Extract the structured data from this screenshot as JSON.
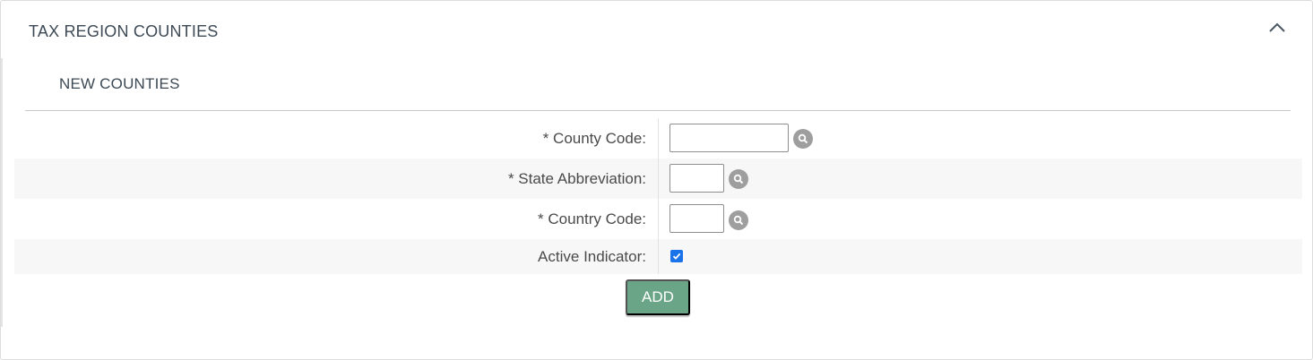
{
  "panel": {
    "title": "TAX REGION COUNTIES",
    "collapse_icon": "chevron-up-icon"
  },
  "section": {
    "title": "NEW COUNTIES"
  },
  "form": {
    "county_code": {
      "label": "*  County Code:",
      "value": "",
      "lookup_icon": "search-icon"
    },
    "state_abbreviation": {
      "label": "*  State Abbreviation:",
      "value": "",
      "lookup_icon": "search-icon"
    },
    "country_code": {
      "label": "*  Country Code:",
      "value": "",
      "lookup_icon": "search-icon"
    },
    "active_indicator": {
      "label": "Active Indicator:",
      "checked": true
    }
  },
  "actions": {
    "add_label": "ADD"
  },
  "colors": {
    "add_button": "#6aa587",
    "checkbox": "#1a73e8",
    "lookup_icon_bg": "#9e9e9e",
    "row_alt_bg": "#f7f7f7"
  }
}
